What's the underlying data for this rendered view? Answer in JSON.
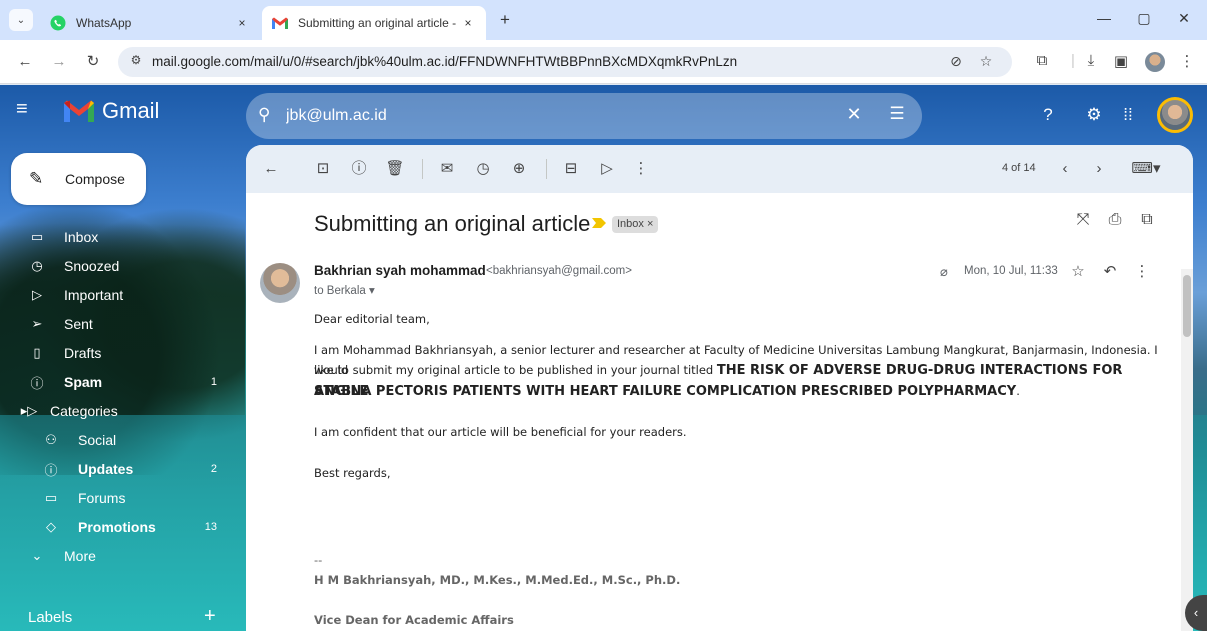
{
  "browser": {
    "tabs": [
      {
        "title": "WhatsApp",
        "close": "×"
      },
      {
        "title": "Submitting an original article - I",
        "close": "×"
      }
    ],
    "new_tab": "+",
    "url": "mail.google.com/mail/u/0/#search/jbk%40ulm.ac.id/FFNDWNFHTWtBBPnnBXcMDXqmkRvPnLzn",
    "window": {
      "minimize": "—",
      "restore": "▢",
      "close": "✕"
    }
  },
  "gmail": {
    "logo_text": "Gmail",
    "search": {
      "value": "jbk@ulm.ac.id"
    },
    "compose_label": "Compose",
    "nav": [
      {
        "label": "Inbox",
        "count": ""
      },
      {
        "label": "Snoozed",
        "count": ""
      },
      {
        "label": "Important",
        "count": ""
      },
      {
        "label": "Sent",
        "count": ""
      },
      {
        "label": "Drafts",
        "count": ""
      },
      {
        "label": "Spam",
        "count": "1"
      },
      {
        "label": "Categories",
        "count": ""
      },
      {
        "label": "Social",
        "count": ""
      },
      {
        "label": "Updates",
        "count": "2"
      },
      {
        "label": "Forums",
        "count": ""
      },
      {
        "label": "Promotions",
        "count": "13"
      },
      {
        "label": "More",
        "count": ""
      }
    ],
    "labels_header": "Labels",
    "labels_add": "+"
  },
  "message": {
    "pagination": "4 of 14",
    "subject": "Submitting an original article",
    "inbox_chip": "Inbox ×",
    "sender_name": "Bakhrian syah mohammad",
    "sender_email": "<bakhriansyah@gmail.com>",
    "to": "to Berkala ▾",
    "date": "Mon, 10 Jul, 11:33",
    "greeting": "Dear editorial team,",
    "para1_a": "I am Mohammad Bakhriansyah, a senior lecturer and researcher at Faculty of Medicine Universitas Lambung Mangkurat, Banjarmasin, Indonesia. I would",
    "para1_b": "like to submit my original article to be published in your journal titled",
    "title_1": "THE RISK OF ADVERSE DRUG-DRUG INTERACTIONS FOR STABLE",
    "title_2": "ANGINA PECTORIS PATIENTS WITH HEART FAILURE COMPLICATION PRESCRIBED POLYPHARMACY",
    "title_end": ".",
    "para2": "I am confident that our article will be beneficial for your readers.",
    "closing": "Best regards,",
    "sig_dash": "--",
    "sig_name": "H M Bakhriansyah, MD., M.Kes., M.Med.Ed., M.Sc., Ph.D.",
    "sig_role": "Vice Dean for Academic Affairs"
  }
}
